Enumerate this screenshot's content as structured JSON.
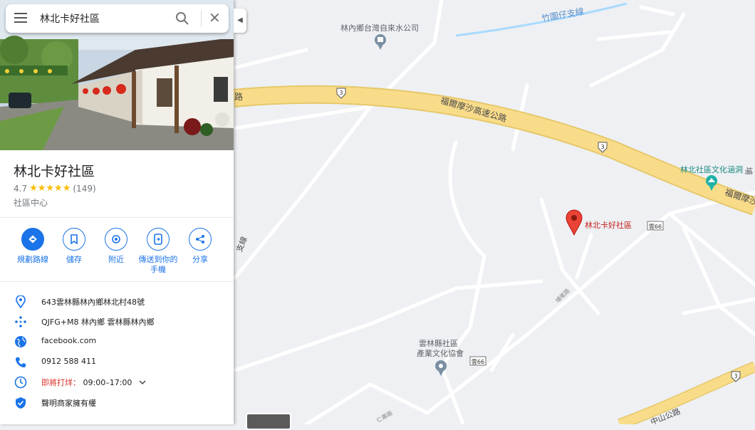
{
  "search": {
    "query": "林北卡好社區"
  },
  "place": {
    "title": "林北卡好社區",
    "rating": "4.7",
    "stars": "★★★★★",
    "reviews": "(149)",
    "category": "社區中心"
  },
  "actions": [
    {
      "label": "規劃路線"
    },
    {
      "label": "儲存"
    },
    {
      "label": "附近"
    },
    {
      "label": "傳送到你的手機"
    },
    {
      "label": "分享"
    }
  ],
  "info": {
    "address": "643雲林縣林內鄉林北村48號",
    "plus_code": "QJFG+M8 林內鄉 雲林縣林內鄉",
    "website": "facebook.com",
    "phone": "0912 588 411",
    "hours_status": "即將打烊：",
    "hours": "09:00–17:00",
    "claim": "聲明商家擁有權"
  },
  "map": {
    "labels": {
      "water_company": "林內鄉台灣自來水公司",
      "canal": "竹圍仔支線",
      "freeway": "福爾摩沙高速公路",
      "freeway_right": "福爾摩沙",
      "freeway_left": "路",
      "culture_hall": "林北社區文化涵洞",
      "culture_hall_edge": "埔",
      "marker": "林北卡好社區",
      "road_66_a": "雲66",
      "road_66_b": "雲66",
      "route3_a": "3",
      "route3_b": "3",
      "route3_c": "3",
      "association_1": "雲林縣社區",
      "association_2": "產業文化協會",
      "branch_line": "支線",
      "small_road": "埔墘路",
      "small_road_2": "仁壽路",
      "zhongshan": "中山公路"
    }
  },
  "colors": {
    "accent": "#1a73e8",
    "highway": "#f9dc8a",
    "marker": "#ea4335",
    "water": "#aadaff"
  }
}
